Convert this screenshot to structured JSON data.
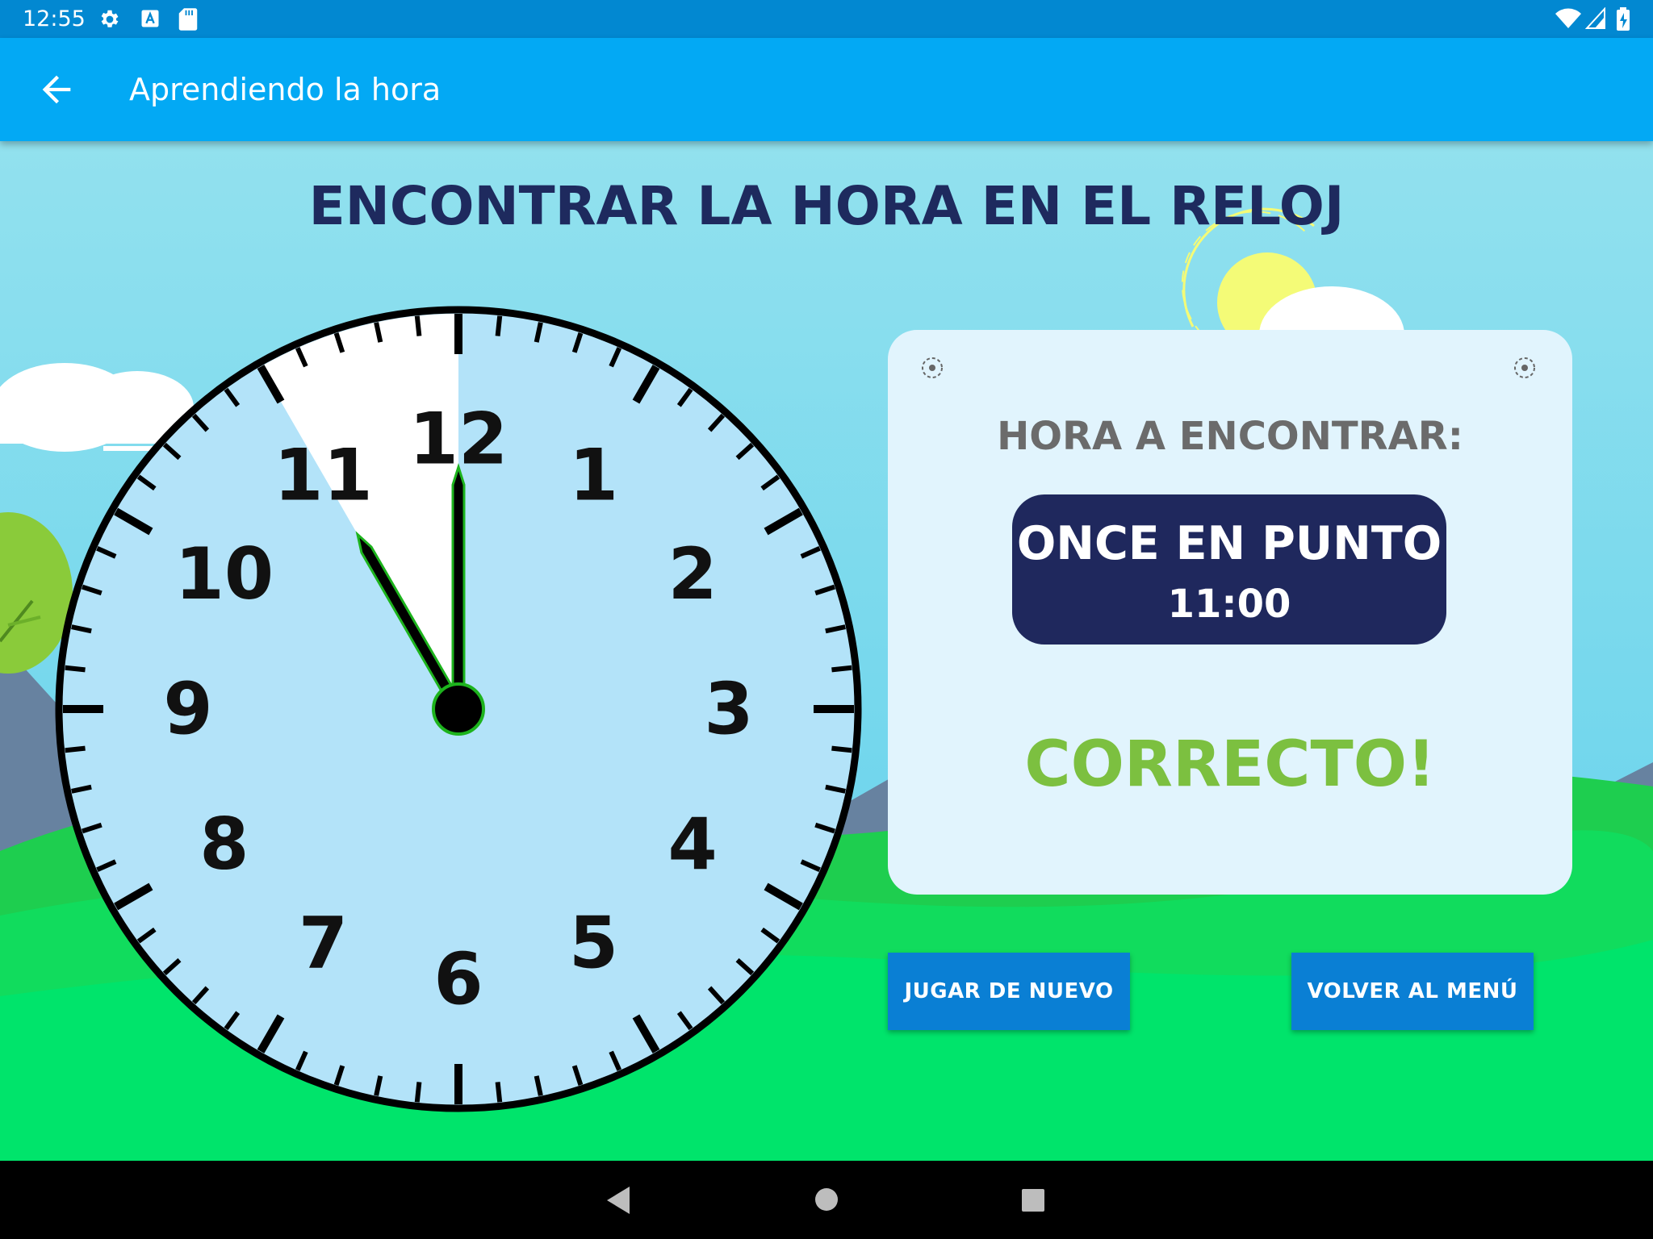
{
  "status_bar": {
    "time": "12:55"
  },
  "app_bar": {
    "title": "Aprendiendo la hora"
  },
  "page": {
    "title": "ENCONTRAR LA HORA EN EL RELOJ"
  },
  "clock": {
    "numerals": [
      "12",
      "1",
      "2",
      "3",
      "4",
      "5",
      "6",
      "7",
      "8",
      "9",
      "10",
      "11"
    ],
    "hour": 11,
    "minute": 0,
    "face_color": "#b3e3f9",
    "hand_outline_color": "#1db31d"
  },
  "card": {
    "label": "HORA A ENCONTRAR:",
    "time_words": "ONCE EN PUNTO",
    "time_digits": "11:00",
    "result": "CORRECTO!",
    "result_color": "#7cc040"
  },
  "buttons": {
    "replay": "JUGAR DE NUEVO",
    "menu": "VOLVER AL MENÚ"
  },
  "colors": {
    "status_bar": "#0288d1",
    "app_bar": "#03a9f4",
    "title": "#1e2a5e",
    "button": "#0a7fd4",
    "time_box": "#1f285d"
  }
}
